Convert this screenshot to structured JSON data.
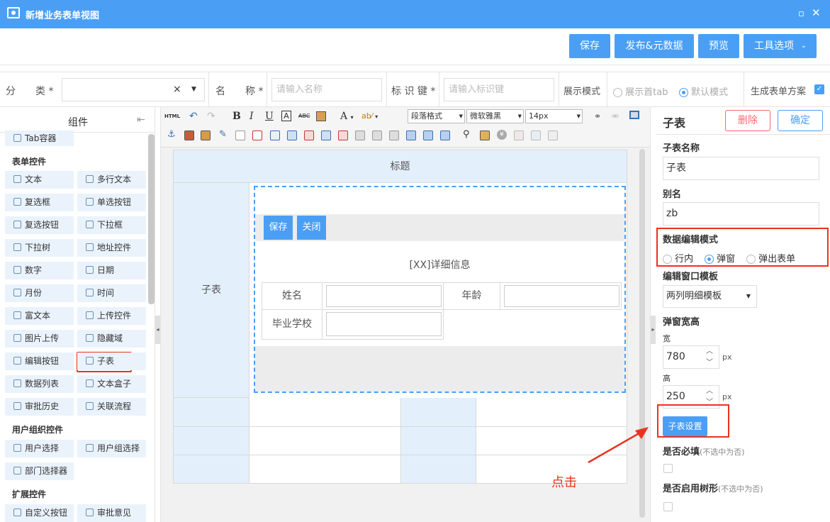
{
  "window": {
    "title": "新增业务表单视图"
  },
  "toolbar": {
    "save": "保存",
    "publish": "发布&元数据",
    "preview": "预览",
    "tools": "工具选项"
  },
  "form": {
    "category_label": "分　　类 *",
    "name_label": "名　　称 *",
    "name_placeholder": "请输入名称",
    "key_label": "标 识 键 *",
    "key_placeholder": "请输入标识键",
    "display_mode_label": "展示模式",
    "mode_first_tab": "展示首tab",
    "mode_default": "默认模式",
    "generate_label": "生成表单方案"
  },
  "components": {
    "header": "组件",
    "tab_container": "Tab容器",
    "sections": {
      "form_controls": "表单控件",
      "user_org": "用户组织控件",
      "extension": "扩展控件"
    },
    "form_items": [
      "文本",
      "多行文本",
      "复选框",
      "单选按钮",
      "复选按钮",
      "下拉框",
      "下拉树",
      "地址控件",
      "数字",
      "日期",
      "月份",
      "时间",
      "富文本",
      "上传控件",
      "图片上传",
      "隐藏域",
      "编辑按钮",
      "子表",
      "数据列表",
      "文本盒子",
      "审批历史",
      "关联流程"
    ],
    "user_items": [
      "用户选择",
      "用户组选择",
      "部门选择器"
    ],
    "ext_items": [
      "自定义按钮",
      "审批意见"
    ]
  },
  "editor": {
    "html_btn": "HTML",
    "paragraph": "段落格式",
    "font": "微软雅黑",
    "size": "14px",
    "table_title": "标题",
    "subtable_label": "子表",
    "sub_save": "保存",
    "sub_close": "关闭",
    "detail_title": "[XX]详细信息",
    "field_name": "姓名",
    "field_age": "年龄",
    "field_school": "毕业学校"
  },
  "annotation": {
    "click_text": "点击",
    "color": "#e8331f"
  },
  "props": {
    "title": "子表",
    "delete": "删除",
    "confirm": "确定",
    "name_label": "子表名称",
    "name_value": "子表",
    "alias_label": "别名",
    "alias_value": "zb",
    "edit_mode_label": "数据编辑模式",
    "mode_inline": "行内",
    "mode_popup": "弹窗",
    "mode_popup_form": "弹出表单",
    "template_label": "编辑窗口模板",
    "template_value": "两列明细模板",
    "popup_size_label": "弹窗宽高",
    "width_label": "宽",
    "width_value": "780",
    "height_label": "高",
    "height_value": "250",
    "px": "px",
    "subtable_settings": "子表设置",
    "required_label": "是否必填",
    "required_hint": "(不选中为否)",
    "tree_label": "是否启用树形",
    "tree_hint": "(不选中为否)"
  },
  "colors": {
    "primary": "#4a9ff5",
    "danger": "#f56c6c",
    "highlight": "#e8331f",
    "cell_blue": "#e3f0fc"
  }
}
